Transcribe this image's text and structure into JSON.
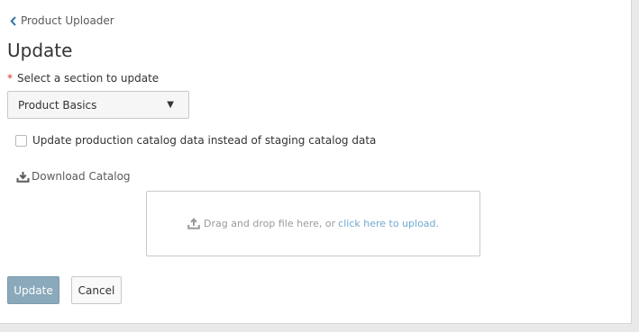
{
  "breadcrumb": {
    "back_label": "Product Uploader"
  },
  "page": {
    "title": "Update"
  },
  "section_select": {
    "required_marker": "*",
    "label": "Select a section to update",
    "selected_value": "Product Basics"
  },
  "production_checkbox": {
    "label": "Update production catalog data instead of staging catalog data",
    "checked": false
  },
  "download": {
    "label": "Download Catalog"
  },
  "dropzone": {
    "text": "Drag and drop file here, or",
    "link_text": "click here to upload."
  },
  "actions": {
    "update_label": "Update",
    "cancel_label": "Cancel"
  },
  "colors": {
    "accent_link": "#6fa9cf",
    "primary_button": "#8aa9bb",
    "required_star": "#d9302b"
  },
  "icons": {
    "back": "chevron-left-icon",
    "select": "caret-down-icon",
    "download": "download-icon",
    "upload": "upload-icon"
  }
}
